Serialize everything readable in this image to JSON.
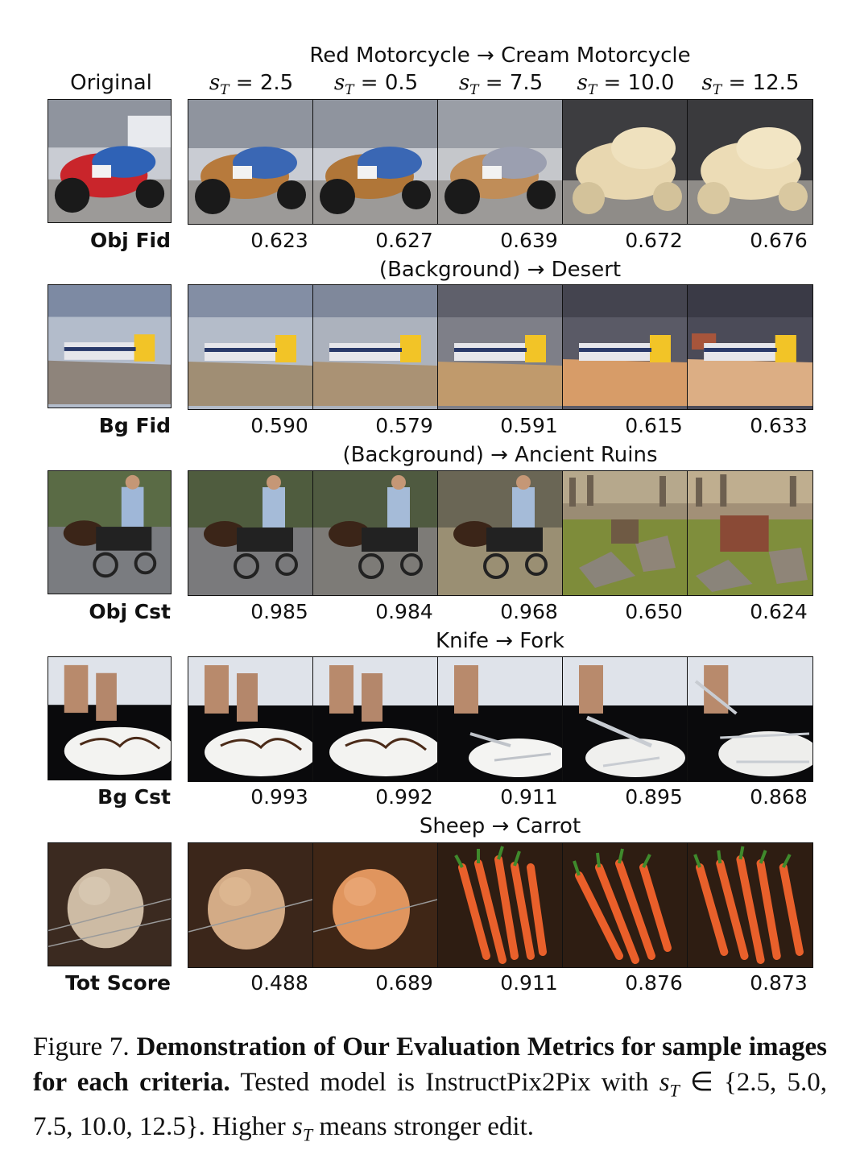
{
  "columns": {
    "original": "Original",
    "scales": [
      {
        "symbol": "s",
        "sub": "T",
        "value": "= 2.5"
      },
      {
        "symbol": "s",
        "sub": "T",
        "value": "= 0.5"
      },
      {
        "symbol": "s",
        "sub": "T",
        "value": "= 7.5"
      },
      {
        "symbol": "s",
        "sub": "T",
        "value": "= 10.0"
      },
      {
        "symbol": "s",
        "sub": "T",
        "value": "= 12.5"
      }
    ]
  },
  "rows": [
    {
      "title": "Red Motorcycle → Cream Motorcycle",
      "metric": "Obj Fid",
      "scores": [
        "0.623",
        "0.627",
        "0.639",
        "0.672",
        "0.676"
      ],
      "scene": "motorcycle"
    },
    {
      "title": "(Background) → Desert",
      "metric": "Bg Fid",
      "scores": [
        "0.590",
        "0.579",
        "0.591",
        "0.615",
        "0.633"
      ],
      "scene": "train"
    },
    {
      "title": "(Background) → Ancient Ruins",
      "metric": "Obj Cst",
      "scores": [
        "0.985",
        "0.984",
        "0.968",
        "0.650",
        "0.624"
      ],
      "scene": "horse-cart"
    },
    {
      "title": "Knife → Fork",
      "metric": "Bg Cst",
      "scores": [
        "0.993",
        "0.992",
        "0.911",
        "0.895",
        "0.868"
      ],
      "scene": "cake"
    },
    {
      "title": "Sheep → Carrot",
      "metric": "Tot Score",
      "scores": [
        "0.488",
        "0.689",
        "0.911",
        "0.876",
        "0.873"
      ],
      "scene": "sheep"
    }
  ],
  "caption": {
    "label": "Figure 7.",
    "bold": "Demonstration of Our Evaluation Metrics for sample images for each criteria.",
    "text1": "Tested model is InstructPix2Pix with",
    "set_symbol": "s",
    "set_sub": "T",
    "set_values": "∈ {2.5, 5.0, 7.5, 10.0, 12.5}.",
    "text2": "Higher",
    "text3": "means stronger edit."
  }
}
